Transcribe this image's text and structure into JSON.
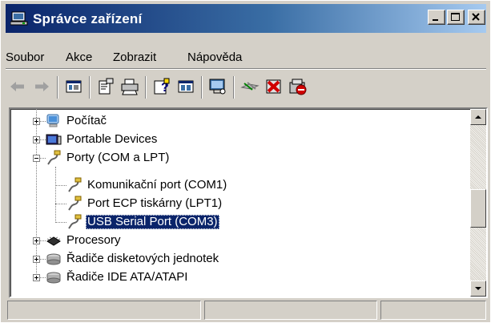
{
  "window": {
    "title": "Správce zařízení"
  },
  "menu": [
    "Soubor",
    "Akce",
    "Zobrazit",
    "Nápověda"
  ],
  "toolbar": {
    "icons": [
      "back-icon",
      "forward-icon",
      "view-icon",
      "properties-icon",
      "print-icon",
      "help-icon",
      "console-icon",
      "scan-icon",
      "update-driver-icon",
      "uninstall-icon",
      "disable-icon"
    ]
  },
  "tree": {
    "nodes": [
      {
        "label": "Počítač",
        "icon": "computer-icon",
        "expanded": false
      },
      {
        "label": "Portable Devices",
        "icon": "portable-devices-icon",
        "expanded": false
      },
      {
        "label": "Porty (COM a LPT)",
        "icon": "port-icon",
        "expanded": true
      },
      {
        "label": "Komunikační port (COM1)",
        "icon": "port-icon",
        "child": true
      },
      {
        "label": "Port ECP tiskárny (LPT1)",
        "icon": "port-icon",
        "child": true
      },
      {
        "label": "USB Serial Port (COM3)",
        "icon": "port-icon",
        "child": true,
        "selected": true
      },
      {
        "label": "Procesory",
        "icon": "processor-icon",
        "expanded": false
      },
      {
        "label": "Řadiče disketových jednotek",
        "icon": "disk-controller-icon",
        "expanded": false
      },
      {
        "label": "Řadiče IDE ATA/ATAPI",
        "icon": "disk-controller-icon",
        "expanded": false
      }
    ]
  },
  "colors": {
    "titlebar_start": "#0a246a",
    "titlebar_end": "#a6caf0",
    "selection": "#0a246a",
    "chrome": "#d4d0c8"
  }
}
